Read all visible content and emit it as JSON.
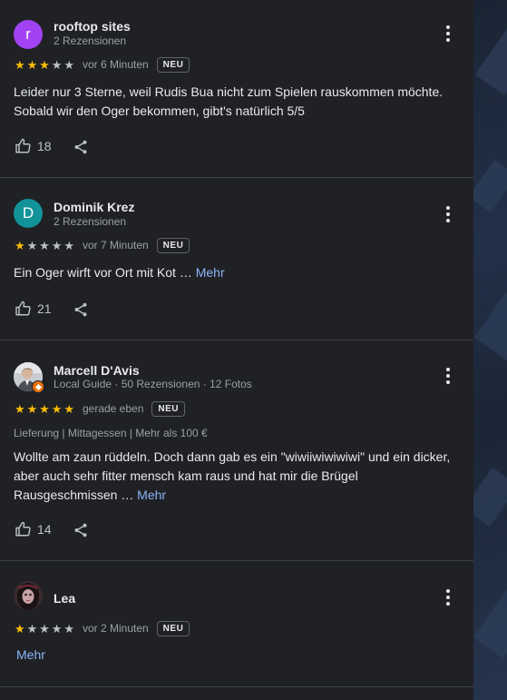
{
  "reviews": [
    {
      "author": "rooftop sites",
      "avatar_letter": "r",
      "avatar_color": "#a142f4",
      "meta": "2 Rezensionen",
      "rating": 3,
      "time": "vor 6 Minuten",
      "badge": "NEU",
      "text": "Leider nur 3 Sterne, weil Rudis Bua nicht zum Spielen rauskommen möchte. Sobald wir den Oger bekommen, gibt's natürlich 5/5",
      "likes": "18"
    },
    {
      "author": "Dominik Krez",
      "avatar_letter": "D",
      "avatar_color": "#12939a",
      "meta": "2 Rezensionen",
      "rating": 1,
      "time": "vor 7 Minuten",
      "badge": "NEU",
      "text": "Ein Oger wirft vor Ort mit Kot … ",
      "more": "Mehr",
      "likes": "21"
    },
    {
      "author": "Marcell D'Avis",
      "meta": "Local Guide · 50 Rezensionen · 12 Fotos",
      "rating": 5,
      "time": "gerade eben",
      "badge": "NEU",
      "tags": "Lieferung  |  Mittagessen  |  Mehr als 100 €",
      "text": "Wollte am zaun rüddeln. Doch dann gab es ein \"wiwiiwiwiwiwi\" und ein dicker, aber auch sehr fitter mensch kam raus und hat mir die Brügel Rausgeschmissen … ",
      "more": "Mehr",
      "likes": "14"
    },
    {
      "author": "Lea",
      "rating": 1,
      "time": "vor 2 Minuten",
      "badge": "NEU",
      "more": "Mehr"
    }
  ],
  "icons": {
    "like": "thumbs-up-icon",
    "share": "share-icon",
    "menu": "more-vert-icon",
    "star": "star-icon",
    "local_guide_badge": "local-guide-badge-icon"
  },
  "colors": {
    "background": "#202124",
    "star": "#fbbc04",
    "link": "#8ab4f8",
    "local_guide_badge": "#e8710a"
  }
}
